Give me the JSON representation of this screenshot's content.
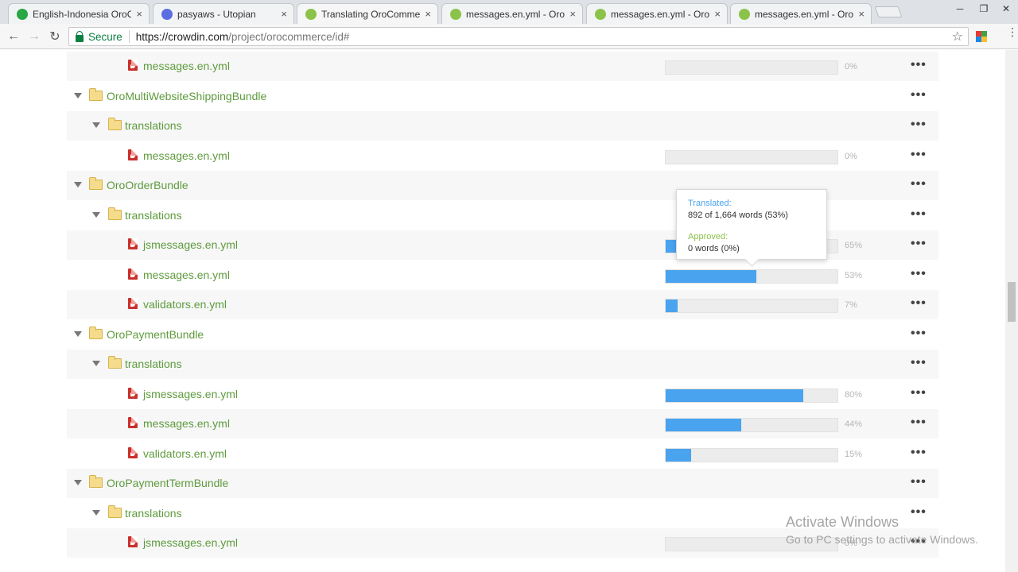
{
  "browser": {
    "tabs": [
      {
        "title": "English-Indonesia OroC",
        "favicon_color": "#28a745"
      },
      {
        "title": "pasyaws - Utopian",
        "favicon_color": "#5b6ee1"
      },
      {
        "title": "Translating OroCommerc",
        "favicon_color": "#8bc34a"
      },
      {
        "title": "messages.en.yml - OroC",
        "favicon_color": "#8bc34a"
      },
      {
        "title": "messages.en.yml - OroC",
        "favicon_color": "#8bc34a"
      },
      {
        "title": "messages.en.yml - OroC",
        "favicon_color": "#8bc34a"
      }
    ],
    "active_tab": 2,
    "close_glyph": "×",
    "address": {
      "secure_label": "Secure",
      "url_host": "https://crowdin.com",
      "url_path": "/project/orocommerce/id#"
    }
  },
  "tree": [
    {
      "type": "file",
      "label": "messages.en.yml",
      "percent": 0,
      "percent_label": "0%"
    },
    {
      "type": "folder",
      "label": "OroMultiWebsiteShippingBundle"
    },
    {
      "type": "subfolder",
      "label": "translations"
    },
    {
      "type": "file",
      "label": "messages.en.yml",
      "percent": 0,
      "percent_label": "0%"
    },
    {
      "type": "folder",
      "label": "OroOrderBundle"
    },
    {
      "type": "subfolder",
      "label": "translations"
    },
    {
      "type": "file",
      "label": "jsmessages.en.yml",
      "percent": 65,
      "percent_label": "65%"
    },
    {
      "type": "file",
      "label": "messages.en.yml",
      "percent": 53,
      "percent_label": "53%"
    },
    {
      "type": "file",
      "label": "validators.en.yml",
      "percent": 7,
      "percent_label": "7%"
    },
    {
      "type": "folder",
      "label": "OroPaymentBundle"
    },
    {
      "type": "subfolder",
      "label": "translations"
    },
    {
      "type": "file",
      "label": "jsmessages.en.yml",
      "percent": 80,
      "percent_label": "80%"
    },
    {
      "type": "file",
      "label": "messages.en.yml",
      "percent": 44,
      "percent_label": "44%"
    },
    {
      "type": "file",
      "label": "validators.en.yml",
      "percent": 15,
      "percent_label": "15%"
    },
    {
      "type": "folder",
      "label": "OroPaymentTermBundle"
    },
    {
      "type": "subfolder",
      "label": "translations"
    },
    {
      "type": "file",
      "label": "jsmessages.en.yml",
      "percent": 0,
      "percent_label": "0%"
    }
  ],
  "more_glyph": "•••",
  "tooltip": {
    "translated_label": "Translated:",
    "translated_value": "892 of 1,664 words (53%)",
    "approved_label": "Approved:",
    "approved_value": "0 words (0%)"
  },
  "watermark": {
    "line1": "Activate Windows",
    "line2": "Go to PC settings to activate Windows."
  },
  "colors": {
    "accent_blue": "#4aa3ee",
    "link_green": "#5e9b3d",
    "approved_green": "#8bc34a"
  }
}
